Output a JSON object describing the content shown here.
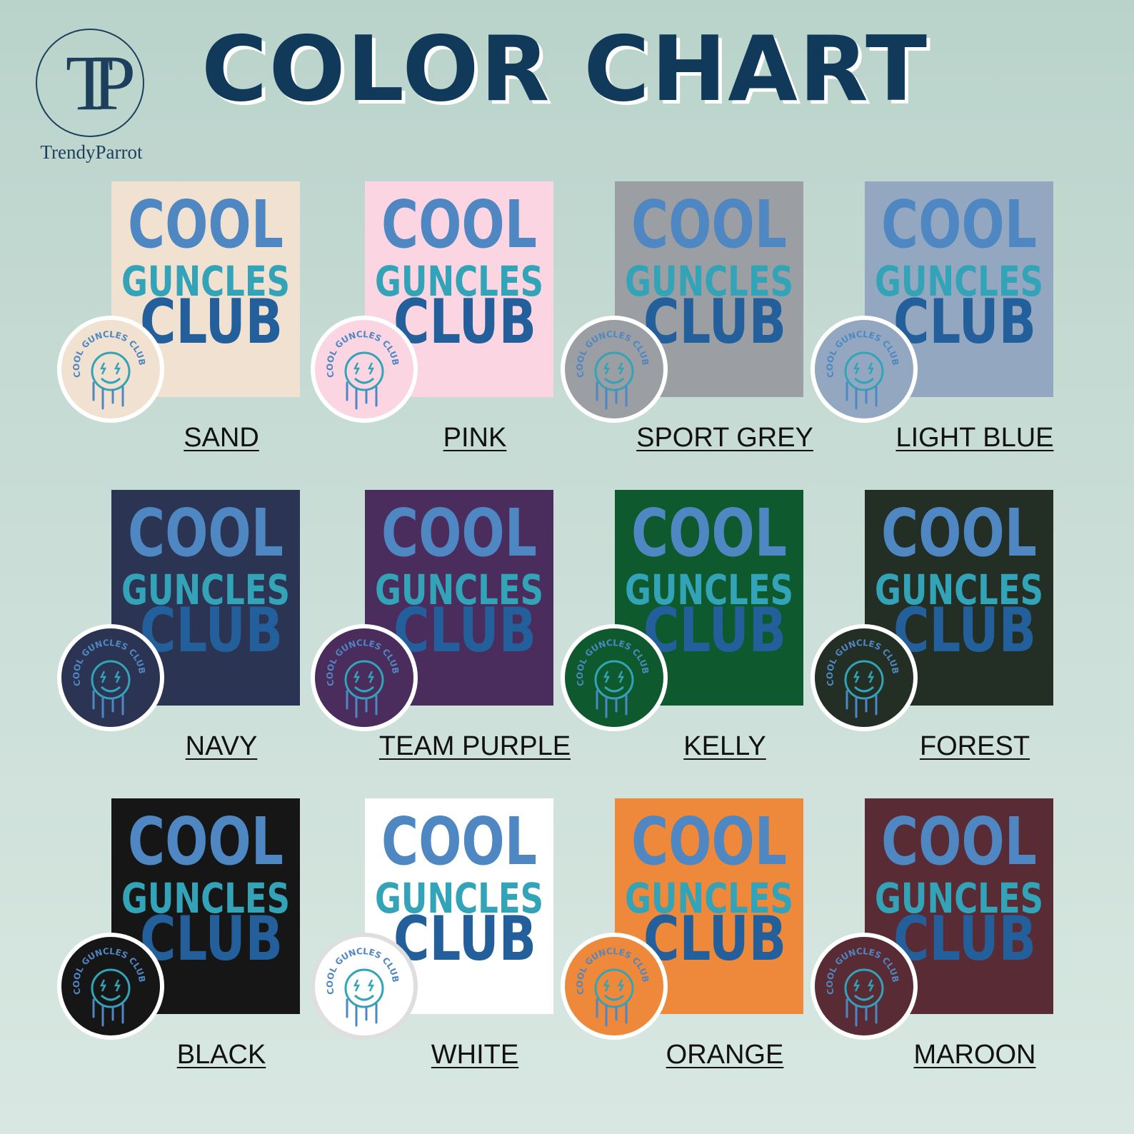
{
  "brand": {
    "monogram": "TP",
    "name": "TrendyParrot"
  },
  "title": "COLOR CHART",
  "design": {
    "words": [
      "COOL",
      "GUNCLES",
      "CLUB"
    ],
    "badge_text": "COOL GUNCLES CLUB",
    "colors": {
      "cool": "#4e87c2",
      "guncles": "#33a3b8",
      "club": "#235f9a"
    }
  },
  "swatches": [
    {
      "name": "SAND",
      "color": "#f1e1d0"
    },
    {
      "name": "PINK",
      "color": "#fbd6e2"
    },
    {
      "name": "SPORT GREY",
      "color": "#9b9ea2"
    },
    {
      "name": "LIGHT BLUE",
      "color": "#93a8c0"
    },
    {
      "name": "NAVY",
      "color": "#2b3553"
    },
    {
      "name": "TEAM PURPLE",
      "color": "#4a2c5d"
    },
    {
      "name": "KELLY",
      "color": "#0e5a2e"
    },
    {
      "name": "FOREST",
      "color": "#232e25"
    },
    {
      "name": "BLACK",
      "color": "#161617"
    },
    {
      "name": "WHITE",
      "color": "#ffffff"
    },
    {
      "name": "ORANGE",
      "color": "#ee883a"
    },
    {
      "name": "MAROON",
      "color": "#582b35"
    }
  ]
}
